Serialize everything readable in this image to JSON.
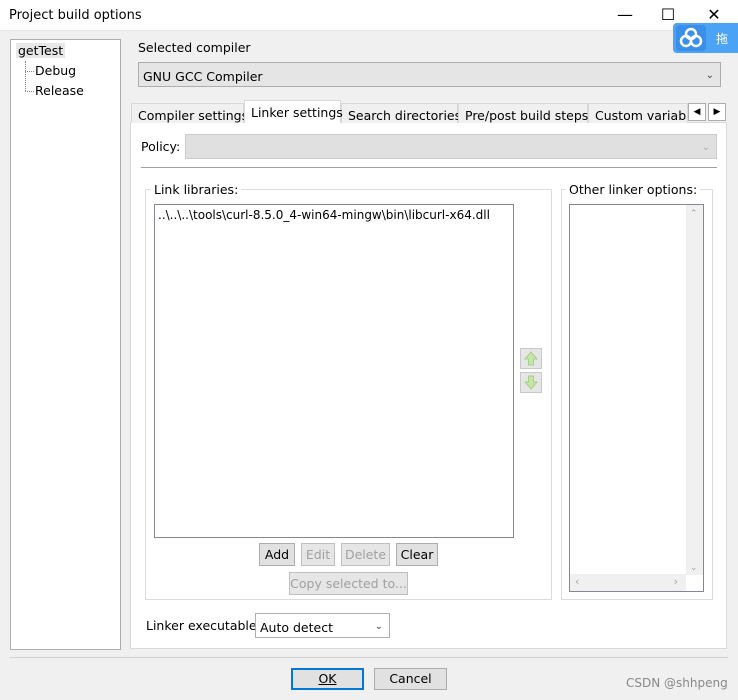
{
  "window": {
    "title": "Project build options",
    "minimize": "—",
    "maximize": "☐",
    "close": "✕",
    "float_badge": "拖"
  },
  "tree": {
    "root": "getTest",
    "children": [
      "Debug",
      "Release"
    ]
  },
  "compiler": {
    "label": "Selected compiler",
    "value": "GNU GCC Compiler"
  },
  "tabs": [
    "Compiler settings",
    "Linker settings",
    "Search directories",
    "Pre/post build steps",
    "Custom variable"
  ],
  "active_tab": "Linker settings",
  "policy": {
    "label": "Policy:",
    "value": ""
  },
  "link_libraries": {
    "label": "Link libraries:",
    "items": [
      "..\\..\\..\\tools\\curl-8.5.0_4-win64-mingw\\bin\\libcurl-x64.dll"
    ]
  },
  "other_options": {
    "label": "Other linker options:"
  },
  "buttons": {
    "add": "Add",
    "edit": "Edit",
    "delete": "Delete",
    "clear": "Clear",
    "copy": "Copy selected to..."
  },
  "linker_exec": {
    "label": "Linker executable:",
    "value": "Auto detect"
  },
  "footer": {
    "ok": "OK",
    "cancel": "Cancel"
  },
  "watermark": "CSDN @shhpeng",
  "colors": {
    "accent": "#0078d7",
    "badge": "#4aa3f5"
  }
}
